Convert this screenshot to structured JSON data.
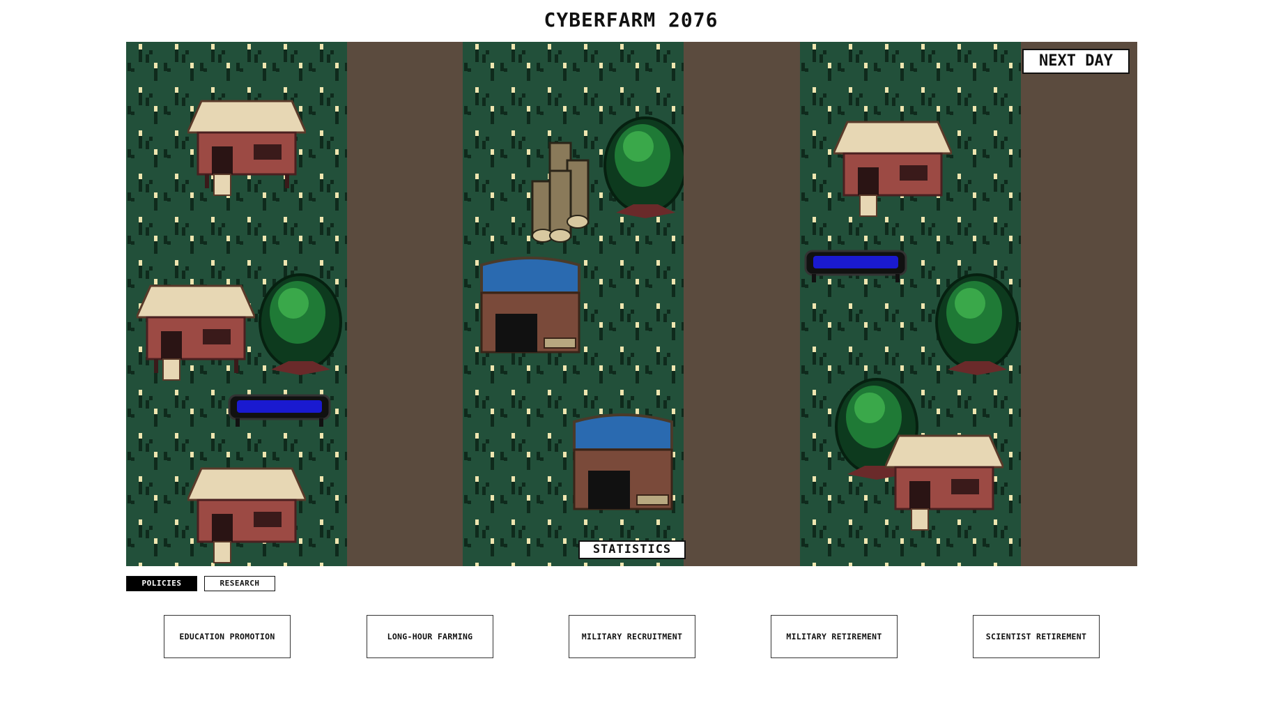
{
  "game": {
    "title": "CYBERFARM 2076"
  },
  "controls": {
    "next_day_label": "NEXT DAY",
    "statistics_label": "STATISTICS"
  },
  "tabs": [
    {
      "label": "POLICIES",
      "active": true
    },
    {
      "label": "RESEARCH",
      "active": false
    }
  ],
  "policies": [
    {
      "label": "EDUCATION PROMOTION"
    },
    {
      "label": "LONG-HOUR FARMING"
    },
    {
      "label": "MILITARY RECRUITMENT"
    },
    {
      "label": "MILITARY RETIREMENT"
    },
    {
      "label": "SCIENTIST RETIREMENT"
    }
  ],
  "colors": {
    "grass": "#22503a",
    "grass_dark": "#0f2a1c",
    "grass_light": "#f0e6b0",
    "road": "#5b4b3e",
    "house_roof": "#e7d7b4",
    "house_wall": "#9c4a44",
    "water": "#1a1ad0"
  },
  "fields": [
    {
      "name": "field-1",
      "objects": [
        "house",
        "house",
        "tree",
        "water-trough",
        "house"
      ]
    },
    {
      "name": "field-2",
      "objects": [
        "log-pile",
        "tree",
        "barn",
        "barn"
      ]
    },
    {
      "name": "field-3",
      "objects": [
        "house",
        "water-trough",
        "tree",
        "tree",
        "house"
      ]
    }
  ]
}
